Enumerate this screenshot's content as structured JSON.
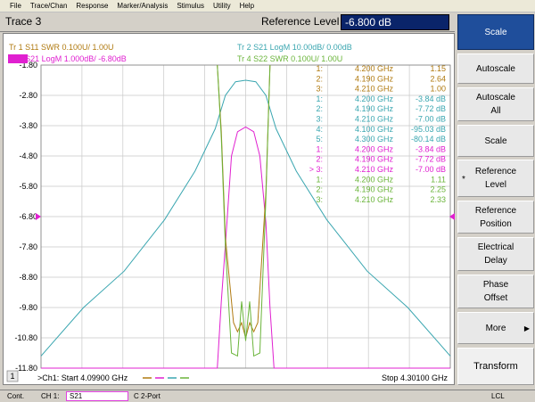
{
  "menu": [
    "File",
    "Trace/Chan",
    "Response",
    "Marker/Analysis",
    "Stimulus",
    "Utility",
    "Help"
  ],
  "header": {
    "trace_title": "Trace 3",
    "ref_label": "Reference Level",
    "ref_value": "-6.800 dB"
  },
  "colors": {
    "tr1": "#b07a10",
    "tr2": "#3aa6b0",
    "tr3": "#e020d0",
    "tr4": "#6ab43a",
    "grid": "#c8c8c8",
    "ref_marker": "#c03030"
  },
  "traces_legend": [
    {
      "id": "tr1",
      "text": "Tr  1   S11  SWR 0.100U/  1.00U"
    },
    {
      "id": "tr2",
      "text": "Tr  2   S21  LogM 10.00dB/  0.00dB"
    },
    {
      "id": "tr3",
      "text": "Tr  3   S21  LogM 1.000dB/  -6.80dB"
    },
    {
      "id": "tr4",
      "text": "Tr  4   S22  SWR  0.100U/  1.00U"
    }
  ],
  "y_axis_labels": [
    "-1.80",
    "-2.80",
    "-3.80",
    "-4.80",
    "-5.80",
    "-6.80",
    "-7.80",
    "-8.80",
    "-9.80",
    "-10.80",
    "-11.80"
  ],
  "marker_table": [
    {
      "tr": "tr1",
      "num": "1:",
      "freq": "4.200 GHz",
      "val": "1.15"
    },
    {
      "tr": "tr1",
      "num": "2:",
      "freq": "4.190 GHz",
      "val": "2.64"
    },
    {
      "tr": "tr1",
      "num": "3:",
      "freq": "4.210 GHz",
      "val": "1.00"
    },
    {
      "tr": "tr2",
      "num": "1:",
      "freq": "4.200 GHz",
      "val": "-3.84 dB"
    },
    {
      "tr": "tr2",
      "num": "2:",
      "freq": "4.190 GHz",
      "val": "-7.72 dB"
    },
    {
      "tr": "tr2",
      "num": "3:",
      "freq": "4.210 GHz",
      "val": "-7.00 dB"
    },
    {
      "tr": "tr2",
      "num": "4:",
      "freq": "4.100 GHz",
      "val": "-95.03 dB"
    },
    {
      "tr": "tr2",
      "num": "5:",
      "freq": "4.300 GHz",
      "val": "-80.14 dB"
    },
    {
      "tr": "tr3",
      "num": "1:",
      "freq": "4.200 GHz",
      "val": "-3.84 dB"
    },
    {
      "tr": "tr3",
      "num": "2:",
      "freq": "4.190 GHz",
      "val": "-7.72 dB"
    },
    {
      "tr": "tr3",
      "num": "> 3:",
      "freq": "4.210 GHz",
      "val": "-7.00 dB"
    },
    {
      "tr": "tr4",
      "num": "1:",
      "freq": "4.200 GHz",
      "val": "1.11"
    },
    {
      "tr": "tr4",
      "num": "2:",
      "freq": "4.190 GHz",
      "val": "2.25"
    },
    {
      "tr": "tr4",
      "num": "3:",
      "freq": "4.210 GHz",
      "val": "2.33"
    }
  ],
  "footer": {
    "channel_badge": "1",
    "start": ">Ch1: Start  4.09900 GHz",
    "stop": "Stop  4.30100 GHz"
  },
  "softkeys": [
    {
      "label": "Scale",
      "active": true
    },
    {
      "label": "Autoscale"
    },
    {
      "label": "Autoscale\nAll"
    },
    {
      "label": "Scale"
    },
    {
      "label": "Reference\nLevel",
      "star": true
    },
    {
      "label": "Reference\nPosition"
    },
    {
      "label": "Electrical\nDelay"
    },
    {
      "label": "Phase\nOffset"
    },
    {
      "label": "More",
      "arrow": true
    },
    {
      "label": "Transform"
    }
  ],
  "status": {
    "cont": "Cont.",
    "ch": "CH 1:",
    "meas": "S21",
    "port": "C  2-Port",
    "lcl": "LCL"
  },
  "chart_data": {
    "type": "line",
    "x_range_ghz": [
      4.099,
      4.301
    ],
    "y_axis": {
      "ref_value": -6.8,
      "scale_db_per_div": 1.0,
      "divisions": 10,
      "range": [
        -11.8,
        -1.8
      ]
    },
    "grid": true,
    "series": [
      {
        "name": "Tr 2 S21 LogM",
        "color": "#3aa6b0",
        "x": [
          4.099,
          4.12,
          4.14,
          4.16,
          4.175,
          4.185,
          4.19,
          4.195,
          4.2,
          4.205,
          4.21,
          4.215,
          4.225,
          4.24,
          4.26,
          4.28,
          4.301
        ],
        "y": [
          -11.4,
          -9.8,
          -8.6,
          -6.9,
          -5.3,
          -3.9,
          -2.8,
          -2.35,
          -2.3,
          -2.35,
          -2.8,
          -3.9,
          -5.3,
          -6.9,
          -8.6,
          -9.8,
          -11.4
        ]
      },
      {
        "name": "Tr 3 S21 LogM",
        "color": "#e020d0",
        "x": [
          4.099,
          4.186,
          4.188,
          4.19,
          4.193,
          4.196,
          4.2,
          4.204,
          4.207,
          4.21,
          4.212,
          4.214,
          4.301
        ],
        "y": [
          -11.8,
          -11.8,
          -9.6,
          -7.72,
          -4.8,
          -4.0,
          -3.84,
          -4.0,
          -4.8,
          -7.0,
          -9.8,
          -11.8,
          -11.8
        ]
      },
      {
        "name": "Tr 1 S11 SWR",
        "color": "#b07a10",
        "x": [
          4.186,
          4.188,
          4.19,
          4.194,
          4.196,
          4.198,
          4.2,
          4.202,
          4.204,
          4.206,
          4.21,
          4.212
        ],
        "y": [
          -1.8,
          -4.0,
          -7.5,
          -10.3,
          -10.6,
          -10.3,
          -10.8,
          -10.3,
          -10.6,
          -10.3,
          -6.0,
          -1.8
        ]
      },
      {
        "name": "Tr 4 S22 SWR",
        "color": "#6ab43a",
        "x": [
          4.186,
          4.188,
          4.19,
          4.193,
          4.196,
          4.198,
          4.2,
          4.202,
          4.204,
          4.207,
          4.21,
          4.212
        ],
        "y": [
          -1.8,
          -4.2,
          -7.8,
          -11.3,
          -11.4,
          -9.6,
          -10.9,
          -9.6,
          -11.4,
          -11.3,
          -6.2,
          -1.8
        ]
      }
    ]
  }
}
